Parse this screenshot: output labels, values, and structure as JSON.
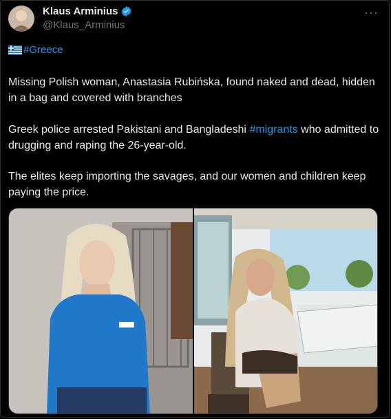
{
  "author": {
    "display_name": "Klaus Arminius",
    "handle": "@Klaus_Arminius",
    "verified": true
  },
  "more_icon": "more-dots-icon",
  "tweet": {
    "flag_emoji": "greece-flag-icon",
    "hashtag": "#Greece",
    "paragraph1": "Missing Polish woman, Anastasia Rubińska, found naked and dead, hidden in a bag and covered with branches",
    "paragraph2_before": "Greek police arrested Pakistani and Bangladeshi ",
    "paragraph2_link": "#migrants",
    "paragraph2_after": " who admitted to drugging and raping the 26-year-old.",
    "paragraph3": "The elites keep importing the savages, and our women and children keep paying the price."
  },
  "colors": {
    "background": "#000000",
    "text": "#e7e9ea",
    "secondary": "#71767b",
    "link": "#1d9bf0",
    "border": "#2f3336"
  }
}
